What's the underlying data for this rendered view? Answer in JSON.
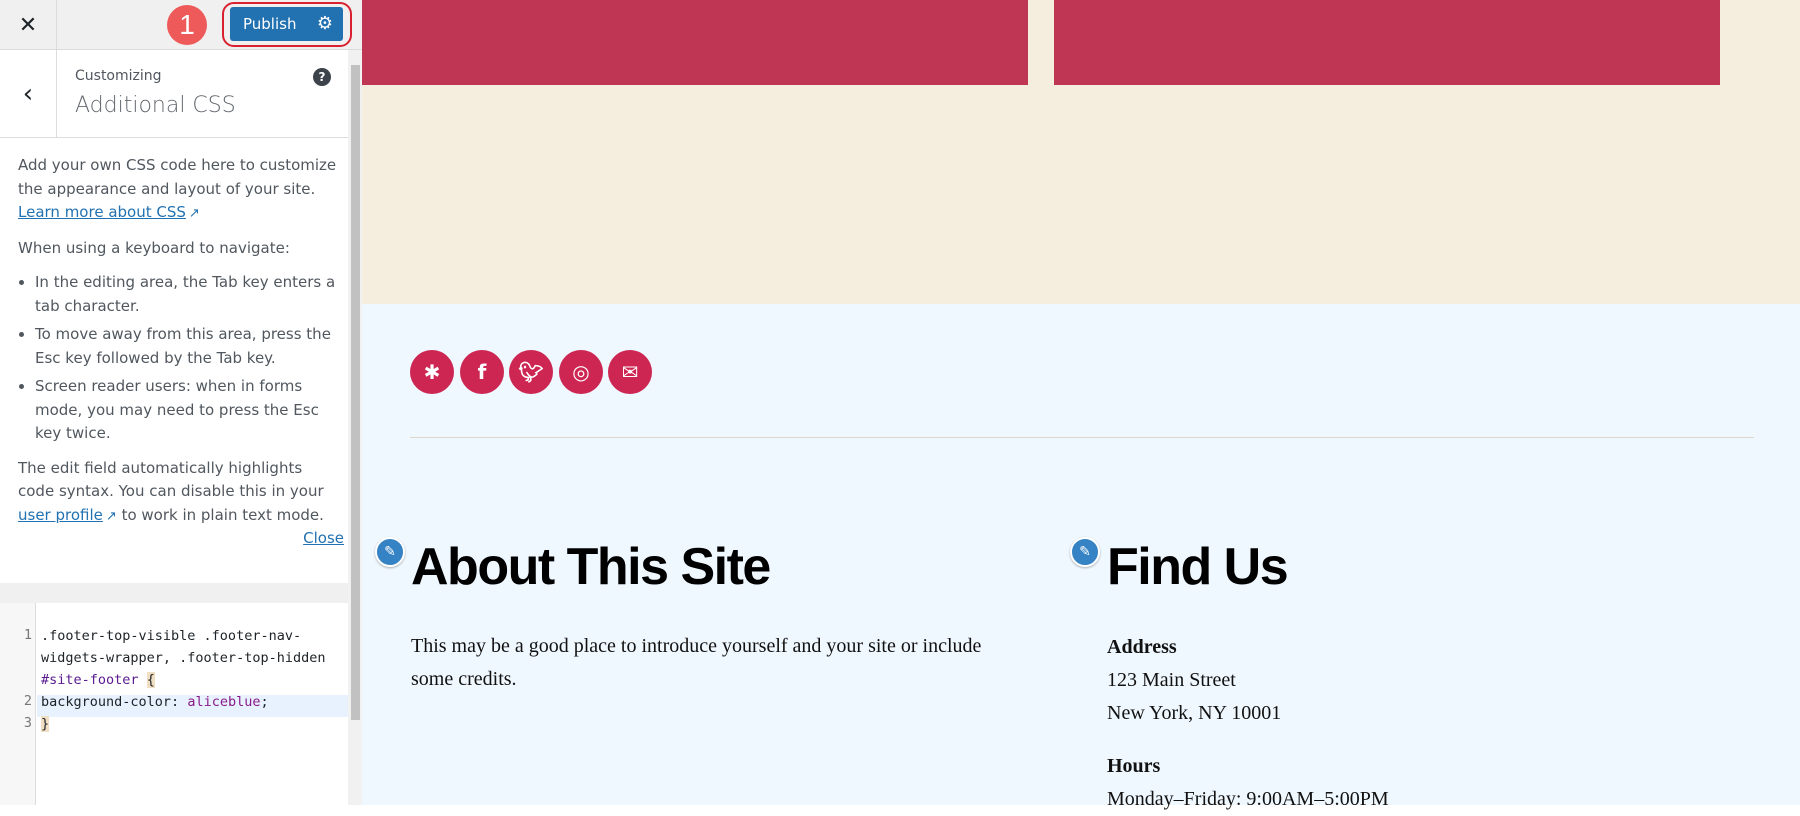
{
  "topbar": {
    "close_icon": "close-icon",
    "step_badge": "1",
    "publish_label": "Publish",
    "settings_icon": "gear-icon"
  },
  "header": {
    "back_icon": "chevron-left-icon",
    "subtitle": "Customizing",
    "title": "Additional CSS",
    "help_icon": "question-icon"
  },
  "description": {
    "intro": "Add your own CSS code here to customize the appearance and layout of your site.",
    "learn_more": "Learn more about CSS",
    "keyboard_heading": "When using a keyboard to navigate:",
    "bullets": [
      "In the editing area, the Tab key enters a tab character.",
      "To move away from this area, press the Esc key followed by the Tab key.",
      "Screen reader users: when in forms mode, you may need to press the Esc key twice."
    ],
    "syntax_pre": "The edit field automatically highlights code syntax. You can disable this in your",
    "user_profile": "user profile",
    "syntax_post": "to work in plain text mode.",
    "close": "Close"
  },
  "editor": {
    "line_numbers": [
      "1",
      "2",
      "3"
    ],
    "line1a": ".footer-top-visible .footer-nav-",
    "line1b": "widgets-wrapper, .footer-top-hidden",
    "line1c_selector": "#site-footer",
    "line1c_brace": "{",
    "line2_prop": "background-color: ",
    "line2_value": "aliceblue",
    "line2_end": ";",
    "line3": "}"
  },
  "colors": {
    "accent": "#2271b1",
    "brand_red": "#cd2653",
    "block_red": "#bf3654",
    "footer_bg": "#f0f8ff",
    "beige": "#f5eedf"
  },
  "footer": {
    "social_icons": [
      "yelp-icon",
      "facebook-icon",
      "twitter-icon",
      "instagram-icon",
      "mail-icon"
    ],
    "about": {
      "title": "About This Site",
      "text": "This may be a good place to introduce yourself and your site or include some credits."
    },
    "find_us": {
      "title": "Find Us",
      "address_label": "Address",
      "address_line1": "123 Main Street",
      "address_line2": "New York, NY 10001",
      "hours_label": "Hours",
      "hours_line": "Monday–Friday: 9:00AM–5:00PM"
    }
  }
}
